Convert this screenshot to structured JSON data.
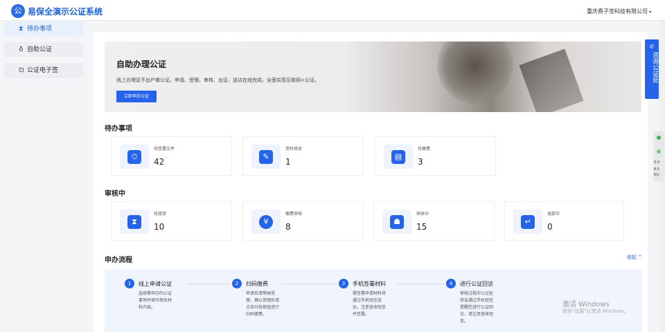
{
  "header": {
    "logo_text": "公",
    "app_title": "易保全演示公证系统",
    "company": "重庆费子签科技有限公司",
    "caret": "▾"
  },
  "sidebar": {
    "items": [
      {
        "icon": "⧗",
        "label": "待办事项"
      },
      {
        "icon": "♁",
        "label": "自助公证"
      },
      {
        "icon": "⊡",
        "label": "公证电子签"
      }
    ]
  },
  "banner": {
    "title": "自助办理公证",
    "description": "线上办理足不出户做公证。申请、受理、审核、出证、送达在线完成，全面实现互联网+公证。",
    "button": "立即申办公证"
  },
  "pending": {
    "title": "待办事项",
    "cards": [
      {
        "icon": "⏱",
        "label": "待签署文件",
        "value": "42"
      },
      {
        "icon": "✎",
        "label": "资料修改",
        "value": "1"
      },
      {
        "icon": "▤",
        "label": "待缴费",
        "value": "3"
      }
    ]
  },
  "reviewing": {
    "title": "审核中",
    "cards": [
      {
        "icon": "⧗",
        "label": "待接受",
        "value": "10"
      },
      {
        "icon": "¥",
        "label": "缴费审核",
        "value": "8"
      },
      {
        "icon": "☗",
        "label": "审核中",
        "value": "15"
      },
      {
        "icon": "↵",
        "label": "退款中",
        "value": "0"
      }
    ]
  },
  "process": {
    "title": "申办流程",
    "collapse": "收起 ^",
    "steps": [
      {
        "num": "1",
        "title": "线上申请公证",
        "desc": "选择需申办的公证事项并填写相关材料内容。"
      },
      {
        "num": "2",
        "title": "扫码缴费",
        "desc": "申请后请等候受理，确认受理后请点击付款按钮进行扫码缴费。"
      },
      {
        "num": "3",
        "title": "手机签署材料",
        "desc": "需签署申请材料将通过手机短信送达，注意查收短信并签署。"
      },
      {
        "num": "4",
        "title": "进行公证回访",
        "desc": "审核过程中公证处将会通过手机短信提醒您进行公证回访，请注意查收短信。"
      }
    ]
  },
  "consult": {
    "icon": "✆",
    "label": "咨询公证处"
  },
  "watermark": {
    "line1": "激活 Windows",
    "line2": "转到\"设置\"以激活 Windows。"
  },
  "widget": {
    "t1": "0.0",
    "t2": "8.5",
    "t3": "K/s"
  }
}
